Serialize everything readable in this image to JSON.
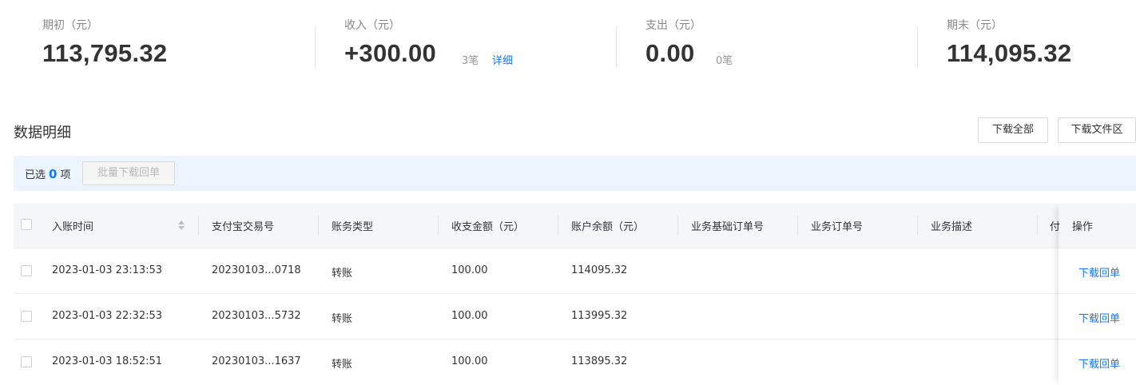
{
  "summary": {
    "opening": {
      "label": "期初（元）",
      "value": "113,795.32"
    },
    "income": {
      "label": "收入（元）",
      "value": "+300.00",
      "count": "3笔",
      "detail_link": "详细"
    },
    "expense": {
      "label": "支出（元）",
      "value": "0.00",
      "count": "0笔"
    },
    "closing": {
      "label": "期末（元）",
      "value": "114,095.32"
    }
  },
  "section": {
    "title": "数据明细",
    "download_all": "下载全部",
    "download_files": "下载文件区"
  },
  "selection": {
    "prefix": "已选",
    "count": "0",
    "suffix": "项",
    "batch_button": "批量下载回单"
  },
  "table": {
    "headers": {
      "time": "入账时间",
      "trade_no": "支付宝交易号",
      "type": "账务类型",
      "amount": "收支金额（元）",
      "balance": "账户余额（元）",
      "base_order": "业务基础订单号",
      "order": "业务订单号",
      "desc": "业务描述",
      "clipped": "付",
      "action": "操作"
    },
    "rows": [
      {
        "time": "2023-01-03 23:13:53",
        "trade_no": "20230103...0718",
        "type": "转账",
        "amount": "100.00",
        "balance": "114095.32",
        "action": "下载回单"
      },
      {
        "time": "2023-01-03 22:32:53",
        "trade_no": "20230103...5732",
        "type": "转账",
        "amount": "100.00",
        "balance": "113995.32",
        "action": "下载回单"
      },
      {
        "time": "2023-01-03 18:52:51",
        "trade_no": "20230103...1637",
        "type": "转账",
        "amount": "100.00",
        "balance": "113895.32",
        "action": "下载回单"
      }
    ]
  },
  "colors": {
    "accent": "#1677ff",
    "selection_bar": "#ecf4fe",
    "header_bg": "#f5f6f7"
  }
}
